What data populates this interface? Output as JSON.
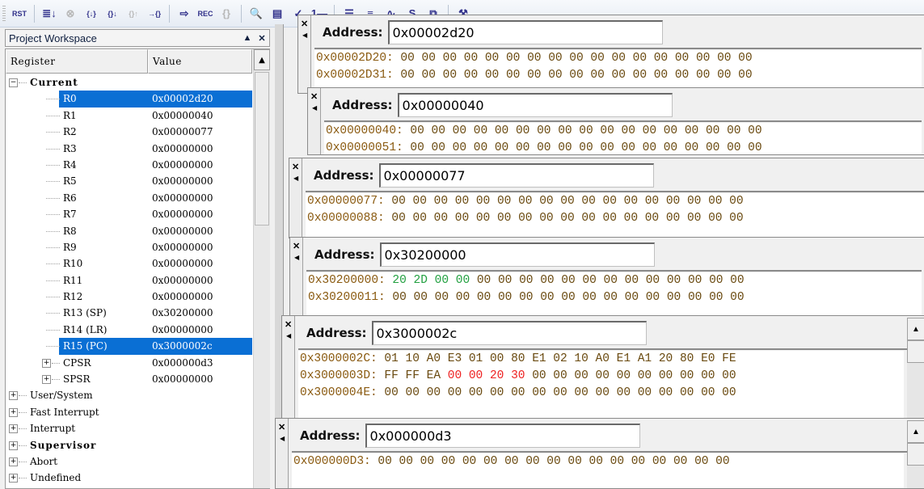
{
  "toolbar": {
    "buttons": [
      {
        "name": "reset-button",
        "glyph": "RST",
        "icon": "reset-icon"
      },
      {
        "name": "step-to-cursor-button",
        "glyph": "≣↓",
        "icon": "run-icon"
      },
      {
        "name": "stop-button",
        "glyph": "⊗",
        "icon": "stop-icon",
        "dim": true
      },
      {
        "name": "step-into-button",
        "glyph": "{↓}",
        "icon": "step-into-icon"
      },
      {
        "name": "step-over-button",
        "glyph": "{}↓",
        "icon": "step-over-icon"
      },
      {
        "name": "step-out-button",
        "glyph": "{}↑",
        "icon": "step-out-icon",
        "dim": true
      },
      {
        "name": "run-to-cursor-button",
        "glyph": "→{}",
        "icon": "run-to-cursor-icon"
      },
      {
        "name": "show-next-statement-button",
        "glyph": "⇨",
        "icon": "arrow-icon"
      },
      {
        "name": "trace-record-button",
        "glyph": "REC",
        "icon": "record-icon"
      },
      {
        "name": "trace-button",
        "glyph": "{}",
        "icon": "trace-icon",
        "dim": true
      },
      {
        "name": "disassembly-button",
        "glyph": "🔍",
        "icon": "magnifier-icon"
      },
      {
        "name": "performance-analyzer-button",
        "glyph": "▤",
        "icon": "chart-icon"
      },
      {
        "name": "code-coverage-button",
        "glyph": "✓",
        "icon": "code-coverage-icon"
      },
      {
        "name": "serial-window-button",
        "glyph": "1▬",
        "icon": "serial-icon"
      },
      {
        "name": "memory-window-button",
        "glyph": "☰",
        "icon": "memory-icon"
      },
      {
        "name": "symbols-button",
        "glyph": "≡",
        "icon": "symbols-icon"
      },
      {
        "name": "logic-analyzer-button",
        "glyph": "∿",
        "icon": "logic-analyzer-icon"
      },
      {
        "name": "system-viewer-button",
        "glyph": "S",
        "icon": "system-viewer-icon"
      },
      {
        "name": "toolbox-button",
        "glyph": "⧉",
        "icon": "toolbox-icon"
      },
      {
        "name": "debug-settings-button",
        "glyph": "⚒",
        "icon": "hammer-icon"
      }
    ]
  },
  "workspace": {
    "title": "Project Workspace",
    "columns": {
      "register": "Register",
      "value": "Value"
    },
    "rows": [
      {
        "label": "Current",
        "value": "",
        "level": 0,
        "expander": "−",
        "bold": true
      },
      {
        "label": "R0",
        "value": "0x00002d20",
        "level": 2,
        "selected": true
      },
      {
        "label": "R1",
        "value": "0x00000040",
        "level": 2
      },
      {
        "label": "R2",
        "value": "0x00000077",
        "level": 2
      },
      {
        "label": "R3",
        "value": "0x00000000",
        "level": 2
      },
      {
        "label": "R4",
        "value": "0x00000000",
        "level": 2
      },
      {
        "label": "R5",
        "value": "0x00000000",
        "level": 2
      },
      {
        "label": "R6",
        "value": "0x00000000",
        "level": 2
      },
      {
        "label": "R7",
        "value": "0x00000000",
        "level": 2
      },
      {
        "label": "R8",
        "value": "0x00000000",
        "level": 2
      },
      {
        "label": "R9",
        "value": "0x00000000",
        "level": 2
      },
      {
        "label": "R10",
        "value": "0x00000000",
        "level": 2
      },
      {
        "label": "R11",
        "value": "0x00000000",
        "level": 2
      },
      {
        "label": "R12",
        "value": "0x00000000",
        "level": 2
      },
      {
        "label": "R13 (SP)",
        "value": "0x30200000",
        "level": 2
      },
      {
        "label": "R14 (LR)",
        "value": "0x00000000",
        "level": 2
      },
      {
        "label": "R15 (PC)",
        "value": "0x3000002c",
        "level": 2,
        "selected": true
      },
      {
        "label": "CPSR",
        "value": "0x000000d3",
        "level": 1,
        "expander": "+"
      },
      {
        "label": "SPSR",
        "value": "0x00000000",
        "level": 1,
        "expander": "+"
      },
      {
        "label": "User/System",
        "value": "",
        "level": 0,
        "expander": "+"
      },
      {
        "label": "Fast Interrupt",
        "value": "",
        "level": 0,
        "expander": "+"
      },
      {
        "label": "Interrupt",
        "value": "",
        "level": 0,
        "expander": "+"
      },
      {
        "label": "Supervisor",
        "value": "",
        "level": 0,
        "expander": "+",
        "bold": true
      },
      {
        "label": "Abort",
        "value": "",
        "level": 0,
        "expander": "+"
      },
      {
        "label": "Undefined",
        "value": "",
        "level": 0,
        "expander": "+"
      }
    ]
  },
  "memory_windows": [
    {
      "address_label": "Address:",
      "address": "0x00002d20",
      "lines": [
        {
          "addr": "0x00002D20:",
          "bytes": [
            "00",
            "00",
            "00",
            "00",
            "00",
            "00",
            "00",
            "00",
            "00",
            "00",
            "00",
            "00",
            "00",
            "00",
            "00",
            "00",
            "00"
          ]
        },
        {
          "addr": "0x00002D31:",
          "bytes": [
            "00",
            "00",
            "00",
            "00",
            "00",
            "00",
            "00",
            "00",
            "00",
            "00",
            "00",
            "00",
            "00",
            "00",
            "00",
            "00",
            "00"
          ]
        }
      ]
    },
    {
      "address_label": "Address:",
      "address": "0x00000040",
      "lines": [
        {
          "addr": "0x00000040:",
          "bytes": [
            "00",
            "00",
            "00",
            "00",
            "00",
            "00",
            "00",
            "00",
            "00",
            "00",
            "00",
            "00",
            "00",
            "00",
            "00",
            "00",
            "00"
          ]
        },
        {
          "addr": "0x00000051:",
          "bytes": [
            "00",
            "00",
            "00",
            "00",
            "00",
            "00",
            "00",
            "00",
            "00",
            "00",
            "00",
            "00",
            "00",
            "00",
            "00",
            "00",
            "00"
          ]
        }
      ]
    },
    {
      "address_label": "Address:",
      "address": "0x00000077",
      "lines": [
        {
          "addr": "0x00000077:",
          "bytes": [
            "00",
            "00",
            "00",
            "00",
            "00",
            "00",
            "00",
            "00",
            "00",
            "00",
            "00",
            "00",
            "00",
            "00",
            "00",
            "00",
            "00"
          ]
        },
        {
          "addr": "0x00000088:",
          "bytes": [
            "00",
            "00",
            "00",
            "00",
            "00",
            "00",
            "00",
            "00",
            "00",
            "00",
            "00",
            "00",
            "00",
            "00",
            "00",
            "00",
            "00"
          ]
        }
      ]
    },
    {
      "address_label": "Address:",
      "address": "0x30200000",
      "lines": [
        {
          "addr": "0x30200000:",
          "bytes": [
            "20",
            "2D",
            "00",
            "00",
            "00",
            "00",
            "00",
            "00",
            "00",
            "00",
            "00",
            "00",
            "00",
            "00",
            "00",
            "00",
            "00"
          ],
          "green": [
            0,
            1,
            2,
            3
          ]
        },
        {
          "addr": "0x30200011:",
          "bytes": [
            "00",
            "00",
            "00",
            "00",
            "00",
            "00",
            "00",
            "00",
            "00",
            "00",
            "00",
            "00",
            "00",
            "00",
            "00",
            "00",
            "00"
          ]
        }
      ]
    },
    {
      "address_label": "Address:",
      "address": "0x3000002c",
      "lines": [
        {
          "addr": "0x3000002C:",
          "bytes": [
            "01",
            "10",
            "A0",
            "E3",
            "01",
            "00",
            "80",
            "E1",
            "02",
            "10",
            "A0",
            "E1",
            "A1",
            "20",
            "80",
            "E0",
            "FE"
          ]
        },
        {
          "addr": "0x3000003D:",
          "bytes": [
            "FF",
            "FF",
            "EA",
            "00",
            "00",
            "20",
            "30",
            "00",
            "00",
            "00",
            "00",
            "00",
            "00",
            "00",
            "00",
            "00",
            "00"
          ],
          "red": [
            3,
            4,
            5,
            6
          ]
        },
        {
          "addr": "0x3000004E:",
          "bytes": [
            "00",
            "00",
            "00",
            "00",
            "00",
            "00",
            "00",
            "00",
            "00",
            "00",
            "00",
            "00",
            "00",
            "00",
            "00",
            "00",
            "00"
          ]
        }
      ]
    },
    {
      "address_label": "Address:",
      "address": "0x000000d3",
      "lines": [
        {
          "addr": "0x000000D3:",
          "bytes": [
            "00",
            "00",
            "00",
            "00",
            "00",
            "00",
            "00",
            "00",
            "00",
            "00",
            "00",
            "00",
            "00",
            "00",
            "00",
            "00",
            "00"
          ]
        }
      ]
    }
  ]
}
